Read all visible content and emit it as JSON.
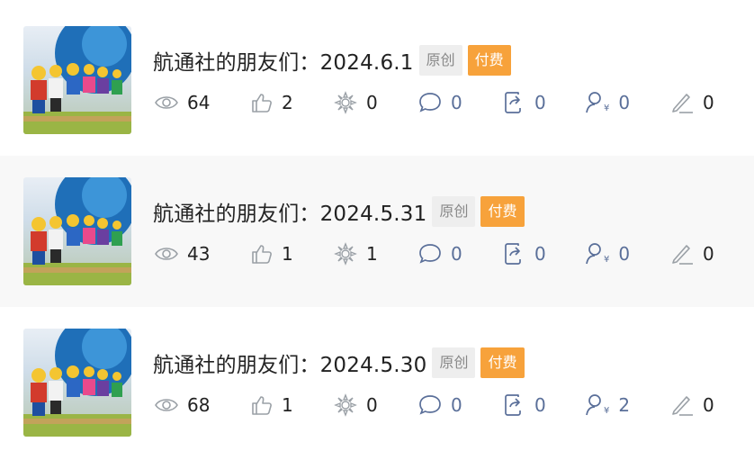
{
  "articles": [
    {
      "title": "航通社的朋友们：2024.6.1",
      "tag_original": "原创",
      "tag_paid": "付费",
      "views": "64",
      "likes": "2",
      "appreciations": "0",
      "comments": "0",
      "shares": "0",
      "paid_users": "0",
      "edits": "0"
    },
    {
      "title": "航通社的朋友们：2024.5.31",
      "tag_original": "原创",
      "tag_paid": "付费",
      "views": "43",
      "likes": "1",
      "appreciations": "1",
      "comments": "0",
      "shares": "0",
      "paid_users": "0",
      "edits": "0"
    },
    {
      "title": "航通社的朋友们：2024.5.30",
      "tag_original": "原创",
      "tag_paid": "付费",
      "views": "68",
      "likes": "1",
      "appreciations": "0",
      "comments": "0",
      "shares": "0",
      "paid_users": "2",
      "edits": "0"
    }
  ],
  "icons": {
    "views": "eye-icon",
    "likes": "thumbs-up-icon",
    "appreciations": "flower-icon",
    "comments": "comment-icon",
    "shares": "share-icon",
    "paid_users": "paid-user-icon",
    "edits": "pencil-icon"
  },
  "paid_tag_color": "#f7a23b",
  "stat_blue_color": "#5a6f99"
}
